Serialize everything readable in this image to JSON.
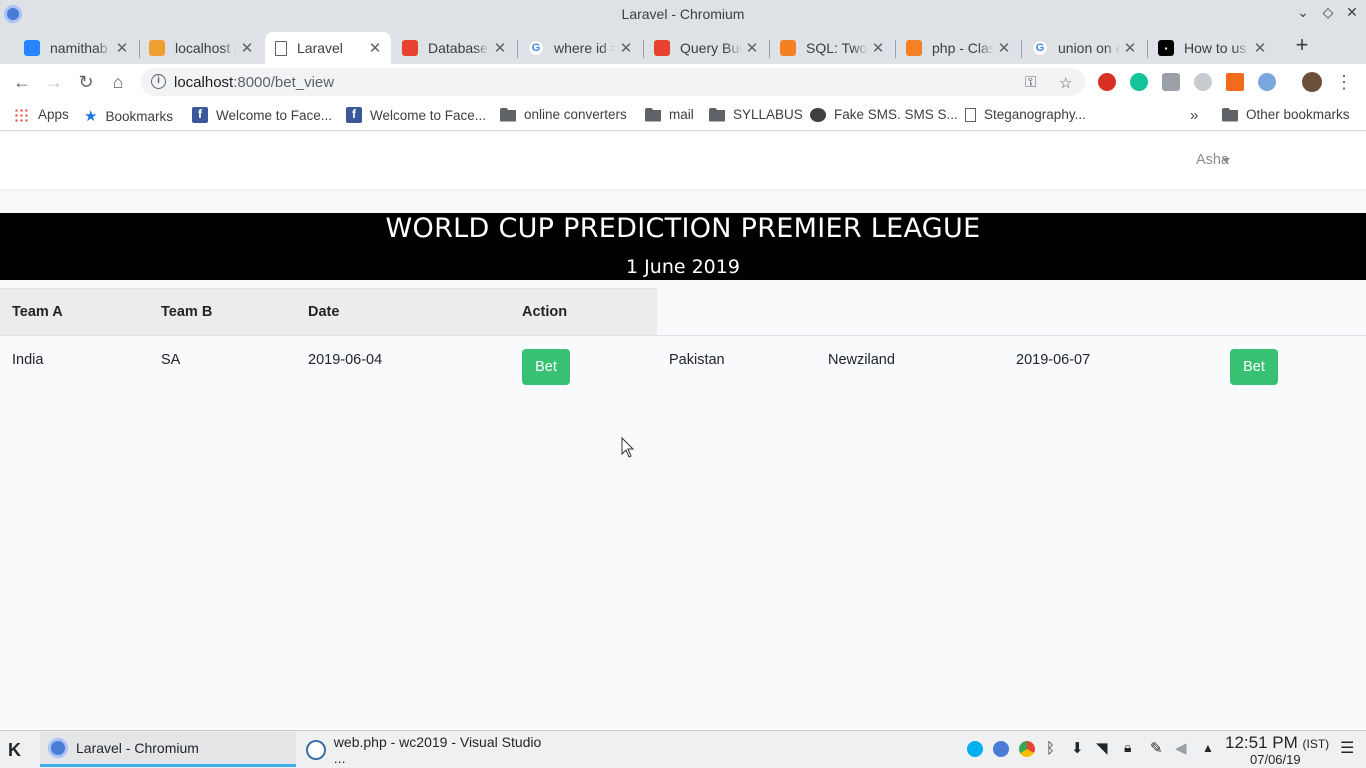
{
  "window": {
    "title": "Laravel - Chromium"
  },
  "tabs": [
    {
      "label": "namithab / ",
      "icon": "bitbucket-icon",
      "color": "#2684ff"
    },
    {
      "label": "localhost / ",
      "icon": "phpmyadmin-icon",
      "color": "#f0a030"
    },
    {
      "label": "Laravel",
      "icon": "page-icon",
      "color": "#5f6368"
    },
    {
      "label": "Database: ",
      "icon": "laravel-icon",
      "color": "#e74430"
    },
    {
      "label": "where id = ",
      "icon": "google-icon",
      "color": "#4285f4"
    },
    {
      "label": "Query Buil",
      "icon": "laravel-icon",
      "color": "#e74430"
    },
    {
      "label": "SQL: Two s",
      "icon": "stackoverflow-icon",
      "color": "#f48024"
    },
    {
      "label": "php - Class",
      "icon": "stackoverflow-icon",
      "color": "#f48024"
    },
    {
      "label": "union on e",
      "icon": "google-icon",
      "color": "#4285f4"
    },
    {
      "label": "How to us",
      "icon": "dev-icon",
      "color": "#000000"
    }
  ],
  "address_bar": {
    "host": "localhost",
    "port_path": ":8000/bet_view"
  },
  "bookmarks": [
    {
      "label": "Apps",
      "icon": "apps-grid-icon"
    },
    {
      "label": "Bookmarks",
      "icon": "star-icon"
    },
    {
      "label": "Welcome to Face...",
      "icon": "facebook-icon"
    },
    {
      "label": "Welcome to Face...",
      "icon": "facebook-icon"
    },
    {
      "label": "online converters",
      "icon": "folder-icon"
    },
    {
      "label": "mail",
      "icon": "folder-icon"
    },
    {
      "label": "SYLLABUS",
      "icon": "folder-icon"
    },
    {
      "label": "Fake SMS. SMS S...",
      "icon": "globe-icon"
    },
    {
      "label": "Steganography...",
      "icon": "page-icon"
    }
  ],
  "other_bookmarks": "Other bookmarks",
  "navbar": {
    "user": "Asha"
  },
  "banner": {
    "title": "WORLD CUP PREDICTION PREMIER LEAGUE",
    "date": "1 June 2019"
  },
  "table": {
    "headers": [
      "Team A",
      "Team B",
      "Date",
      "Action"
    ],
    "matches": [
      {
        "team_a": "India",
        "team_b": "SA",
        "date": "2019-06-04",
        "action": "Bet"
      },
      {
        "team_a": "Pakistan",
        "team_b": "Newziland",
        "date": "2019-06-07",
        "action": "Bet"
      }
    ]
  },
  "taskbar": {
    "tasks": [
      {
        "label": "Laravel - Chromium",
        "icon": "chromium-icon"
      },
      {
        "label": "web.php - wc2019 - Visual Studio ...",
        "icon": "vscode-icon"
      }
    ],
    "clock": {
      "time": "12:51 PM",
      "zone": "(IST)",
      "date": "07/06/19"
    }
  },
  "colors": {
    "bet_button": "#38c172",
    "banner_bg": "#000000"
  }
}
